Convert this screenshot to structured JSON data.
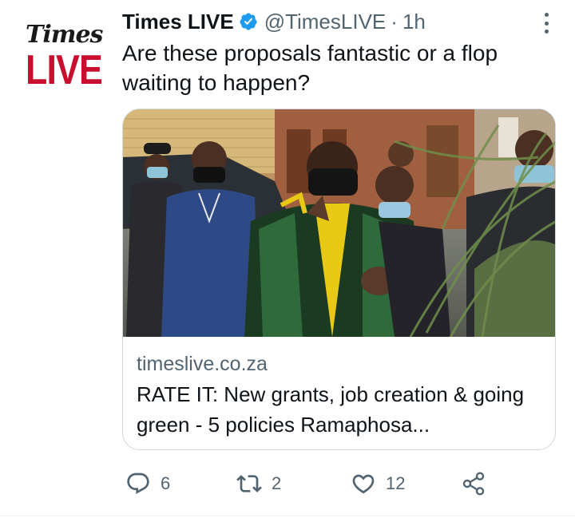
{
  "account": {
    "avatar_logo_top": "Times",
    "avatar_logo_bottom": "LIVE",
    "display_name": "Times LIVE",
    "handle": "@TimesLIVE",
    "separator": "·",
    "time": "1h",
    "verified_icon": "verified-badge-icon"
  },
  "tweet": {
    "text": "Are these proposals fantastic or a flop waiting to happen?"
  },
  "card": {
    "domain": "timeslive.co.za",
    "title": "RATE IT: New grants, job creation & going green - 5 policies Ramaphosa..."
  },
  "actions": {
    "reply_count": "6",
    "retweet_count": "2",
    "like_count": "12"
  },
  "colors": {
    "brand_red": "#c8102e",
    "verified_blue": "#1d9bf0",
    "secondary_text": "#536471",
    "border": "#cfd9de"
  }
}
